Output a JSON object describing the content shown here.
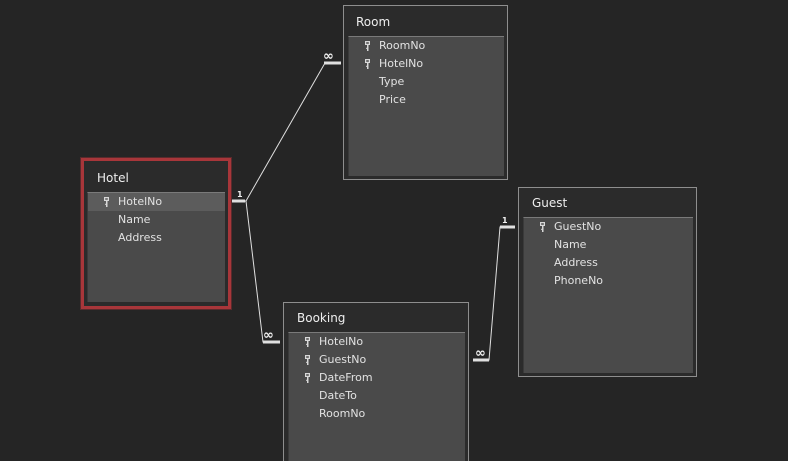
{
  "tables": {
    "room": {
      "title": "Room",
      "fields": [
        {
          "name": "RoomNo",
          "primary_key": true
        },
        {
          "name": "HotelNo",
          "primary_key": true
        },
        {
          "name": "Type",
          "primary_key": false
        },
        {
          "name": "Price",
          "primary_key": false
        }
      ]
    },
    "hotel": {
      "title": "Hotel",
      "selected": true,
      "fields": [
        {
          "name": "HotelNo",
          "primary_key": true
        },
        {
          "name": "Name",
          "primary_key": false
        },
        {
          "name": "Address",
          "primary_key": false
        }
      ]
    },
    "guest": {
      "title": "Guest",
      "fields": [
        {
          "name": "GuestNo",
          "primary_key": true
        },
        {
          "name": "Name",
          "primary_key": false
        },
        {
          "name": "Address",
          "primary_key": false
        },
        {
          "name": "PhoneNo",
          "primary_key": false
        }
      ]
    },
    "booking": {
      "title": "Booking",
      "fields": [
        {
          "name": "HotelNo",
          "primary_key": true
        },
        {
          "name": "GuestNo",
          "primary_key": true
        },
        {
          "name": "DateFrom",
          "primary_key": true
        },
        {
          "name": "DateTo",
          "primary_key": false
        },
        {
          "name": "RoomNo",
          "primary_key": false
        }
      ]
    }
  },
  "relationships": {
    "hotel_room": {
      "one_label": "1",
      "many_label": "∞"
    },
    "hotel_booking": {
      "one_label": "1",
      "many_label": "∞"
    },
    "guest_booking": {
      "one_label": "1",
      "many_label": "∞"
    }
  },
  "colors": {
    "canvas": "#252525",
    "selection_border": "#a8363a",
    "relationship_line": "#e0e0e0",
    "key_icon": "#d8d8d8"
  },
  "icons": {
    "primary_key": "key-icon"
  }
}
